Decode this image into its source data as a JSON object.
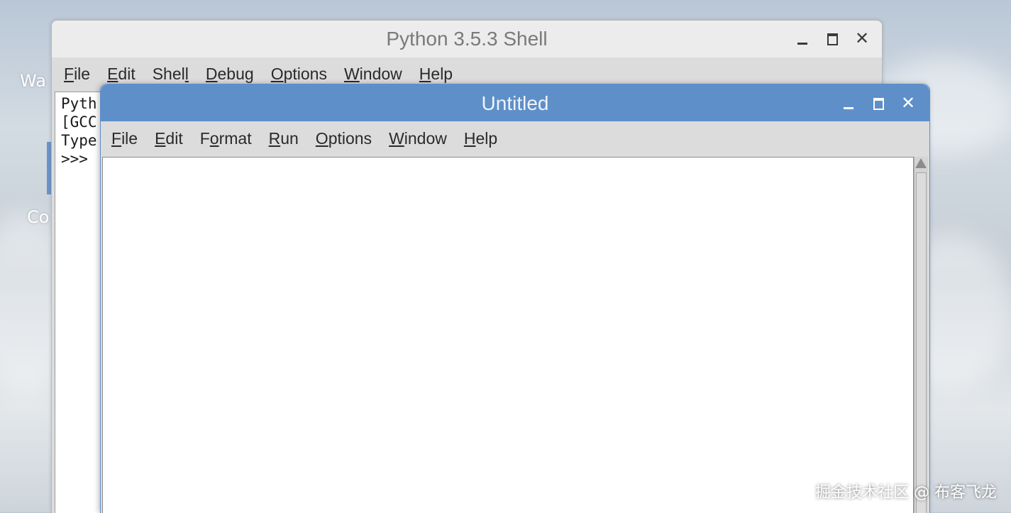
{
  "desktop": {
    "icon_labels": [
      "Wa",
      "Co"
    ]
  },
  "shell": {
    "title": "Python 3.5.3 Shell",
    "menu": [
      {
        "label": "File",
        "mnemonic_index": 0
      },
      {
        "label": "Edit",
        "mnemonic_index": 0
      },
      {
        "label": "Shell",
        "mnemonic_index": 4
      },
      {
        "label": "Debug",
        "mnemonic_index": 0
      },
      {
        "label": "Options",
        "mnemonic_index": 0
      },
      {
        "label": "Window",
        "mnemonic_index": 0
      },
      {
        "label": "Help",
        "mnemonic_index": 0
      }
    ],
    "lines": [
      "Pyth",
      "[GCC",
      "Type",
      ">>>"
    ]
  },
  "editor": {
    "title": "Untitled",
    "menu": [
      {
        "label": "File",
        "mnemonic_index": 0
      },
      {
        "label": "Edit",
        "mnemonic_index": 0
      },
      {
        "label": "Format",
        "mnemonic_index": 1
      },
      {
        "label": "Run",
        "mnemonic_index": 0
      },
      {
        "label": "Options",
        "mnemonic_index": 0
      },
      {
        "label": "Window",
        "mnemonic_index": 0
      },
      {
        "label": "Help",
        "mnemonic_index": 0
      }
    ],
    "content": ""
  },
  "window_controls": {
    "minimize_icon": "minimize-icon",
    "maximize_icon": "maximize-icon",
    "close_icon": "close-icon",
    "close_glyph": "✕"
  },
  "colors": {
    "editor_titlebar": "#5e8fc9",
    "shell_titlebar": "#ececec",
    "menubar": "#dcdcdc"
  },
  "watermark": "掘金技术社区 @ 布客飞龙"
}
